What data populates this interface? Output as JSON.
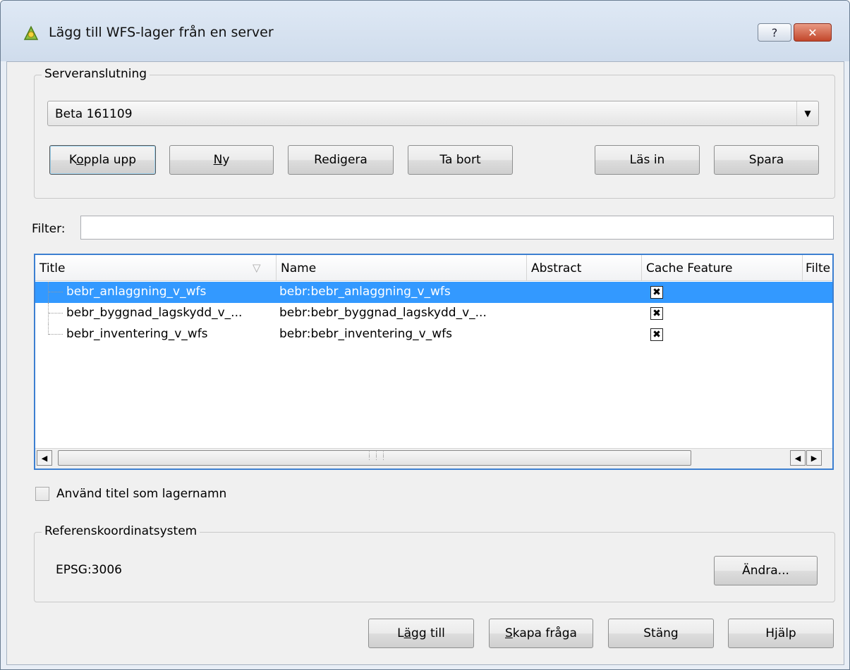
{
  "window": {
    "title": "Lägg till WFS-lager från en server",
    "help_glyph": "?",
    "close_glyph": "✕"
  },
  "server": {
    "group_title": "Serveranslutning",
    "selected": "Beta 161109",
    "buttons": {
      "connect": "Koppla upp",
      "new": "Ny",
      "edit": "Redigera",
      "remove": "Ta bort",
      "load": "Läs in",
      "save": "Spara"
    }
  },
  "filter": {
    "label": "Filter:",
    "value": ""
  },
  "table": {
    "columns": [
      "Title",
      "Name",
      "Abstract",
      "Cache Feature",
      "Filte"
    ],
    "rows": [
      {
        "title": "bebr_anlaggning_v_wfs",
        "name": "bebr:bebr_anlaggning_v_wfs",
        "abstract": "",
        "cache": true
      },
      {
        "title": "bebr_byggnad_lagskydd_v_...",
        "name": "bebr:bebr_byggnad_lagskydd_v_...",
        "abstract": "",
        "cache": true
      },
      {
        "title": "bebr_inventering_v_wfs",
        "name": "bebr:bebr_inventering_v_wfs",
        "abstract": "",
        "cache": true
      }
    ],
    "selected_row": 0
  },
  "use_title": {
    "label": "Använd titel som lagernamn",
    "checked": false
  },
  "crs": {
    "group_title": "Referenskoordinatsystem",
    "value": "EPSG:3006",
    "change_label": "Ändra..."
  },
  "footer": {
    "add": "Lägg till",
    "build_query": "Skapa fråga",
    "close": "Stäng",
    "help": "Hjälp"
  },
  "colors": {
    "selection": "#3399ff",
    "focus_border": "#3c7fd1",
    "title_bar": "#d7e3f1",
    "close_button": "#c2462a"
  }
}
